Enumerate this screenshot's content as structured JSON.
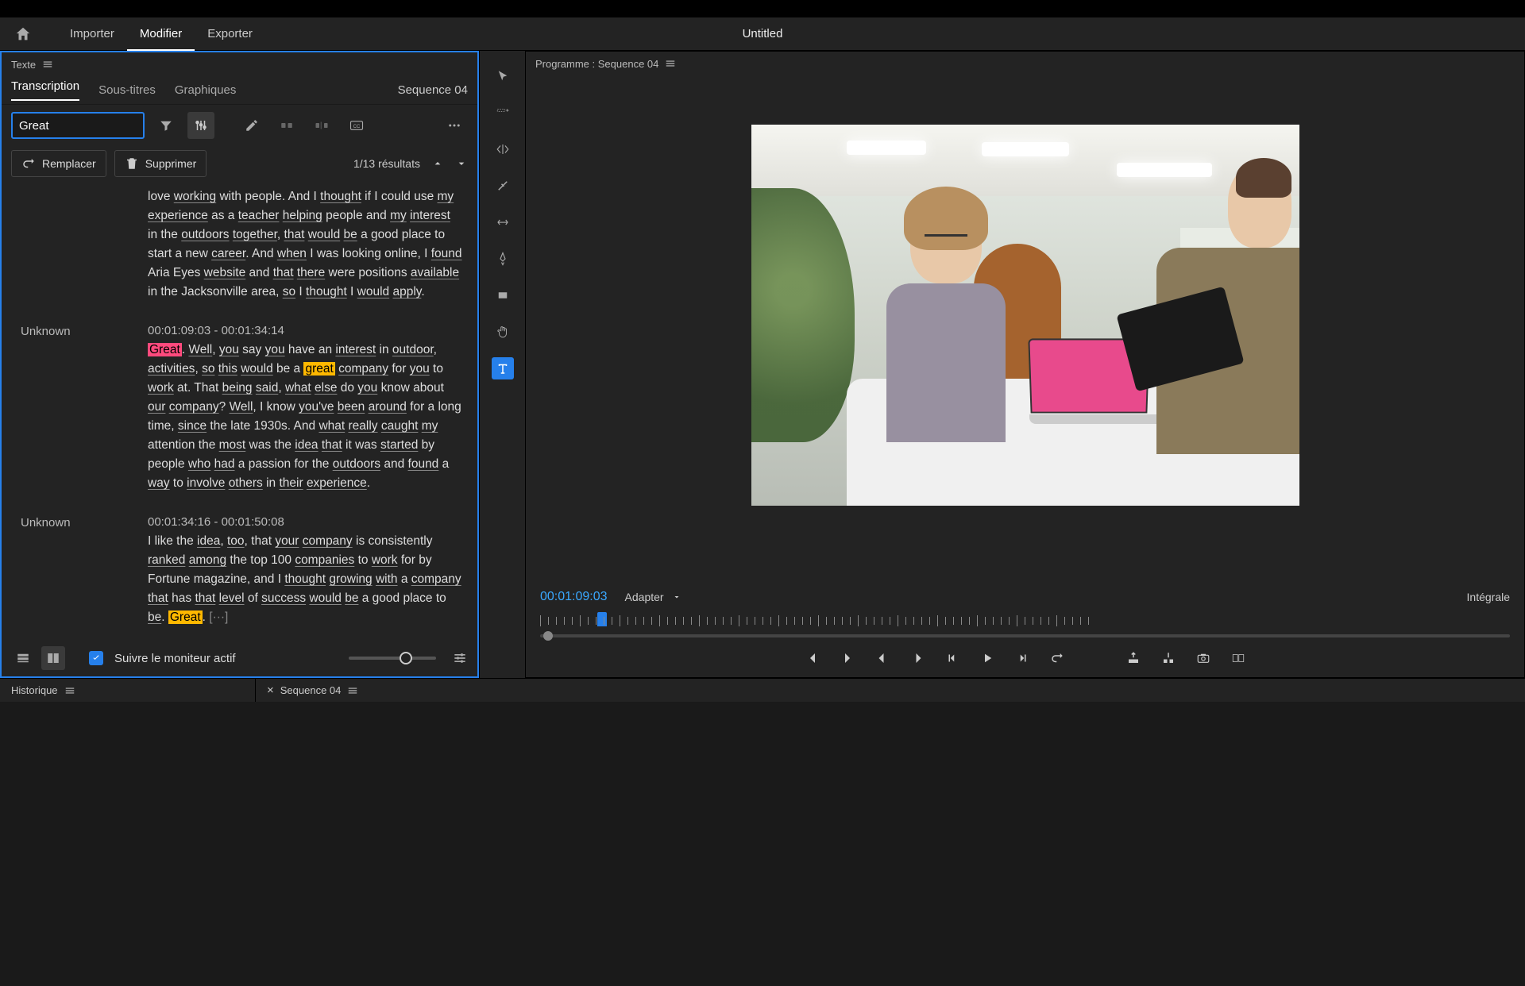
{
  "app": {
    "title": "Untitled",
    "modes": {
      "import": "Importer",
      "edit": "Modifier",
      "export": "Exporter"
    }
  },
  "textPanel": {
    "title": "Texte",
    "tabs": {
      "transcription": "Transcription",
      "subtitles": "Sous-titres",
      "graphics": "Graphiques"
    },
    "sequenceLabel": "Sequence 04",
    "search": {
      "value": "Great"
    },
    "replaceBtn": "Remplacer",
    "deleteBtn": "Supprimer",
    "resultsLabel": "1/13 résultats",
    "followMonitor": "Suivre le moniteur actif",
    "segments": [
      {
        "speaker": "",
        "timecode": "",
        "html": "love <span class='u'>working</span> with people. And I <span class='u'>thought</span> if I could use <span class='u'>my</span> <span class='u'>experience</span> as a <span class='u'>teacher</span> <span class='u'>helping</span> people and <span class='u'>my</span> <span class='u'>interest</span> in the <span class='u'>outdoors</span> <span class='u'>together</span>, <span class='u'>that</span> <span class='u'>would</span> <span class='u'>be</span> a good place to start a new <span class='u'>career</span>. And <span class='u'>when</span> I was looking online, I <span class='u'>found</span> Aria Eyes <span class='u'>website</span> and <span class='u'>that</span> <span class='u'>there</span> were positions <span class='u'>available</span> in the Jacksonville area, <span class='u'>so</span> I <span class='u'>thought</span> I <span class='u'>would</span> <span class='u'>apply</span>."
      },
      {
        "speaker": "Unknown",
        "timecode": "00:01:09:03 - 00:01:34:14",
        "html": "<span class='hl-current'>Great</span>. <span class='u'>Well</span>, <span class='u'>you</span> say <span class='u'>you</span> have an <span class='u'>interest</span> in <span class='u'>outdoor</span>, <span class='u'>activities</span>, <span class='u'>so</span> <span class='u'>this</span> <span class='u'>would</span> be a <span class='hl'>great</span> <span class='u'>company</span> for <span class='u'>you</span> to <span class='u'>work</span> at. That <span class='u'>being</span> <span class='u'>said</span>, <span class='u'>what</span> <span class='u'>else</span> do <span class='u'>you</span> know about <span class='u'>our</span> <span class='u'>company</span>? <span class='u'>Well</span>, I know <span class='u'>you've</span> <span class='u'>been</span> <span class='u'>around</span> for a long time, <span class='u'>since</span> the late 1930s. And <span class='u'>what</span> <span class='u'>really</span> <span class='u'>caught</span> <span class='u'>my</span> attention the <span class='u'>most</span> was the <span class='u'>idea</span> <span class='u'>that</span> it was <span class='u'>started</span> by people <span class='u'>who</span> <span class='u'>had</span> a passion for the <span class='u'>outdoors</span> and <span class='u'>found</span> a <span class='u'>way</span> to <span class='u'>involve</span> <span class='u'>others</span> in <span class='u'>their</span> <span class='u'>experience</span>."
      },
      {
        "speaker": "Unknown",
        "timecode": "00:01:34:16 - 00:01:50:08",
        "html": "I like the <span class='u'>idea</span>, <span class='u'>too</span>, that <span class='u'>your</span> <span class='u'>company</span> is consistently <span class='u'>ranked</span> <span class='u'>among</span> the top 100 <span class='u'>companies</span> to <span class='u'>work</span> for by Fortune magazine, and I <span class='u'>thought</span> <span class='u'>growing</span> <span class='u'>with</span> a <span class='u'>company</span> <span class='u'>that</span> has <span class='u'>that</span> <span class='u'>level</span> of <span class='u'>success</span> <span class='u'>would</span> <span class='u'>be</span> a good place to <span class='u'>be</span>. <span class='hl'>Great</span>. <span class='ellipsis'>[···]</span>"
      }
    ]
  },
  "program": {
    "title": "Programme : Sequence 04",
    "timecode": "00:01:09:03",
    "adapter": "Adapter",
    "integral": "Intégrale"
  },
  "bottom": {
    "history": "Historique",
    "sequence": "Sequence 04"
  }
}
